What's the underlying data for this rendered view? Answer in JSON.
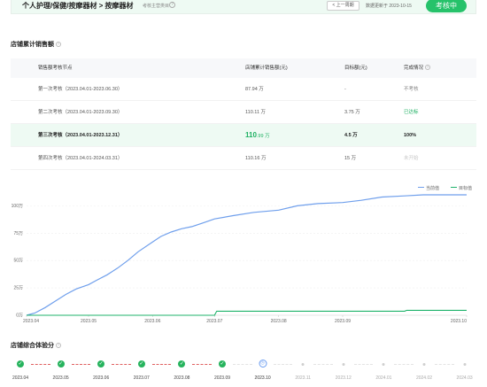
{
  "header": {
    "breadcrumb": "个人护理/保健/按摩器材 > 按摩器材",
    "sub_label": "考核主营类目",
    "help": "?",
    "prev_button": "< 上一周期",
    "updated": "数据更新于 2023-10-15",
    "status": "考核中"
  },
  "sales_section": {
    "title": "店铺累计销售额",
    "help": "?"
  },
  "table": {
    "headers": [
      "销售额考核节点",
      "店铺累计销售额(元)",
      "目标额(元)",
      "完成情况"
    ],
    "rows": [
      {
        "period": "第一次考核（2023.04.01-2023.06.30）",
        "sales": "87.94 万",
        "target": "-",
        "status": "不考核",
        "status_type": "none"
      },
      {
        "period": "第二次考核（2023.04.01-2023.09.30）",
        "sales": "110.11 万",
        "target": "3.75 万",
        "status": "已达标",
        "status_type": "ok"
      },
      {
        "period": "第三次考核（2023.04.01-2023.12.31）",
        "sales_num": "110",
        "sales_unit": ".99 万",
        "target": "4.5 万",
        "status": "100%",
        "status_type": "current"
      },
      {
        "period": "第四次考核（2023.04.01-2024.03.31）",
        "sales": "110.16 万",
        "target": "15 万",
        "status": "未开始",
        "status_type": "pending"
      }
    ]
  },
  "legend": {
    "current": "当前值",
    "target": "目标值"
  },
  "colors": {
    "accent": "#26c26a",
    "current_line": "#6f9fec",
    "target_line": "#1fb36b"
  },
  "chart_data": {
    "type": "line",
    "x_ticks": [
      "2023.04",
      "2023.05",
      "2023.06",
      "2023.07",
      "2023.08",
      "2023.09",
      "2023.10"
    ],
    "y_ticks": [
      "0万",
      "25万",
      "50万",
      "75万",
      "100万"
    ],
    "ylim": [
      0,
      110
    ],
    "series": [
      {
        "name": "当前值",
        "values": [
          [
            "2023-04-01",
            0
          ],
          [
            "2023-04-05",
            2
          ],
          [
            "2023-04-10",
            7
          ],
          [
            "2023-04-15",
            13
          ],
          [
            "2023-04-20",
            19
          ],
          [
            "2023-04-25",
            24
          ],
          [
            "2023-05-01",
            28
          ],
          [
            "2023-05-05",
            32
          ],
          [
            "2023-05-10",
            37
          ],
          [
            "2023-05-15",
            43
          ],
          [
            "2023-05-20",
            50
          ],
          [
            "2023-05-25",
            58
          ],
          [
            "2023-06-01",
            67
          ],
          [
            "2023-06-05",
            72
          ],
          [
            "2023-06-10",
            76
          ],
          [
            "2023-06-15",
            79
          ],
          [
            "2023-06-20",
            81
          ],
          [
            "2023-06-25",
            84
          ],
          [
            "2023-07-01",
            88
          ],
          [
            "2023-07-10",
            91
          ],
          [
            "2023-07-20",
            94
          ],
          [
            "2023-08-01",
            96
          ],
          [
            "2023-08-10",
            100
          ],
          [
            "2023-08-20",
            102
          ],
          [
            "2023-09-01",
            103
          ],
          [
            "2023-09-10",
            105
          ],
          [
            "2023-09-20",
            108
          ],
          [
            "2023-10-01",
            109
          ],
          [
            "2023-10-10",
            110
          ],
          [
            "2023-10-31",
            110
          ]
        ]
      },
      {
        "name": "目标值",
        "values": [
          [
            "2023-04-01",
            0
          ],
          [
            "2023-07-01",
            0
          ],
          [
            "2023-07-02",
            3.75
          ],
          [
            "2023-10-01",
            3.75
          ],
          [
            "2023-10-02",
            4.5
          ],
          [
            "2023-10-31",
            4.5
          ]
        ]
      }
    ]
  },
  "score_section": {
    "title": "店铺综合体验分",
    "help": "?"
  },
  "timeline": {
    "months": [
      "2023.04",
      "2023.05",
      "2023.06",
      "2023.07",
      "2023.08",
      "2023.09",
      "2023.10",
      "2023.11",
      "2023.12",
      "2024.01",
      "2024.02",
      "2024.03"
    ],
    "states": [
      "done",
      "done",
      "done",
      "done",
      "done",
      "done",
      "current",
      "future",
      "future",
      "future",
      "future",
      "future"
    ]
  }
}
